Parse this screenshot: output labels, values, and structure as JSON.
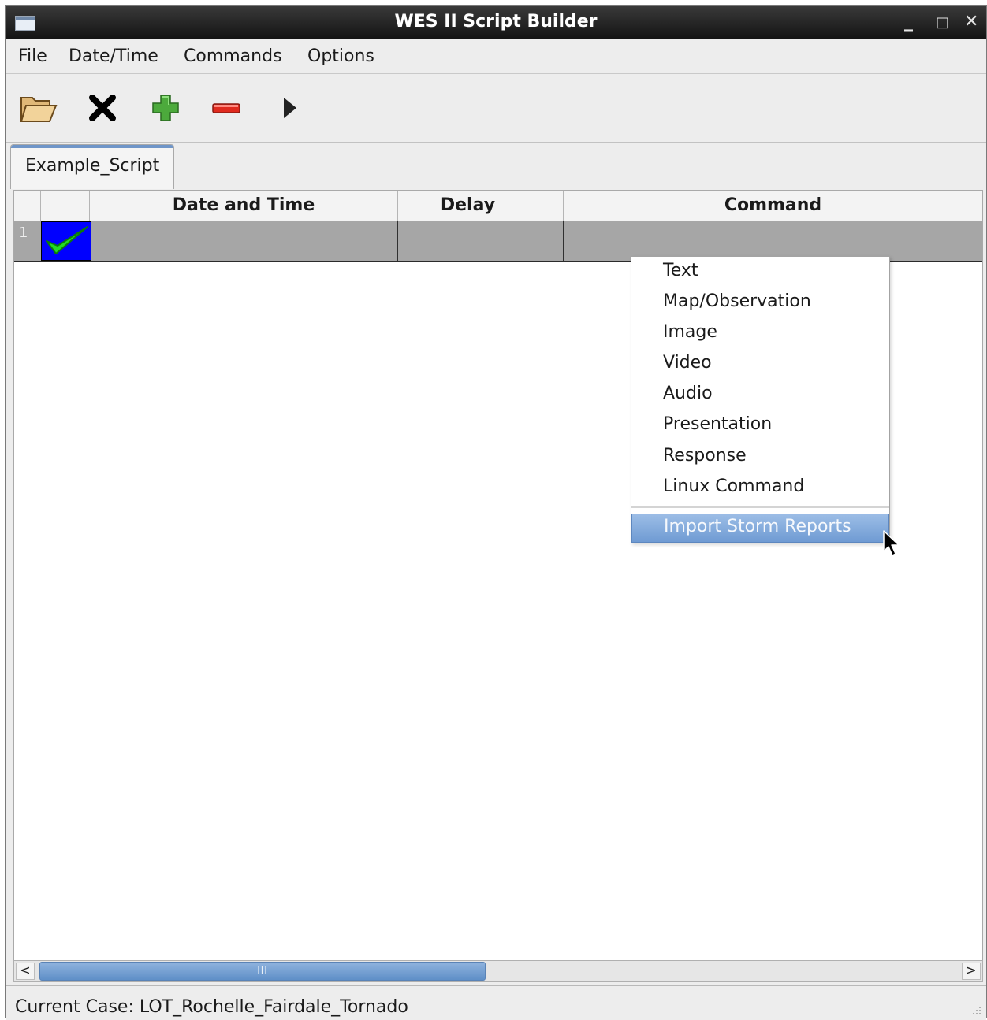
{
  "window": {
    "title": "WES II Script Builder",
    "controls": [
      "_",
      "□",
      "✕"
    ]
  },
  "menubar": {
    "items": [
      "File",
      "Date/Time",
      "Commands",
      "Options"
    ]
  },
  "toolbar": {
    "icons": [
      "open-folder-icon",
      "close-x-icon",
      "add-plus-icon",
      "remove-minus-icon",
      "play-icon"
    ]
  },
  "tabs": [
    {
      "label": "Example_Script"
    }
  ],
  "table": {
    "columns": [
      "",
      "",
      "Date and Time",
      "Delay",
      "",
      "Command"
    ],
    "rows": [
      {
        "num": "1",
        "status": "check-icon",
        "date_time": "",
        "delay": "",
        "command": ""
      }
    ]
  },
  "popup_menu": {
    "items": [
      "Text",
      "Map/Observation",
      "Image",
      "Video",
      "Audio",
      "Presentation",
      "Response",
      "Linux Command"
    ],
    "highlighted_item": "Import Storm Reports"
  },
  "scrollbar": {
    "left": "<",
    "right": ">",
    "grip": "III"
  },
  "status": {
    "text": "Current Case: LOT_Rochelle_Fairdale_Tornado"
  },
  "colors": {
    "titlebar": "#1e1e1e",
    "row_selected": "#a6a6a6",
    "status_cell": "#0000ff",
    "check": "#22dd22",
    "highlight": "#7ba3d8"
  }
}
